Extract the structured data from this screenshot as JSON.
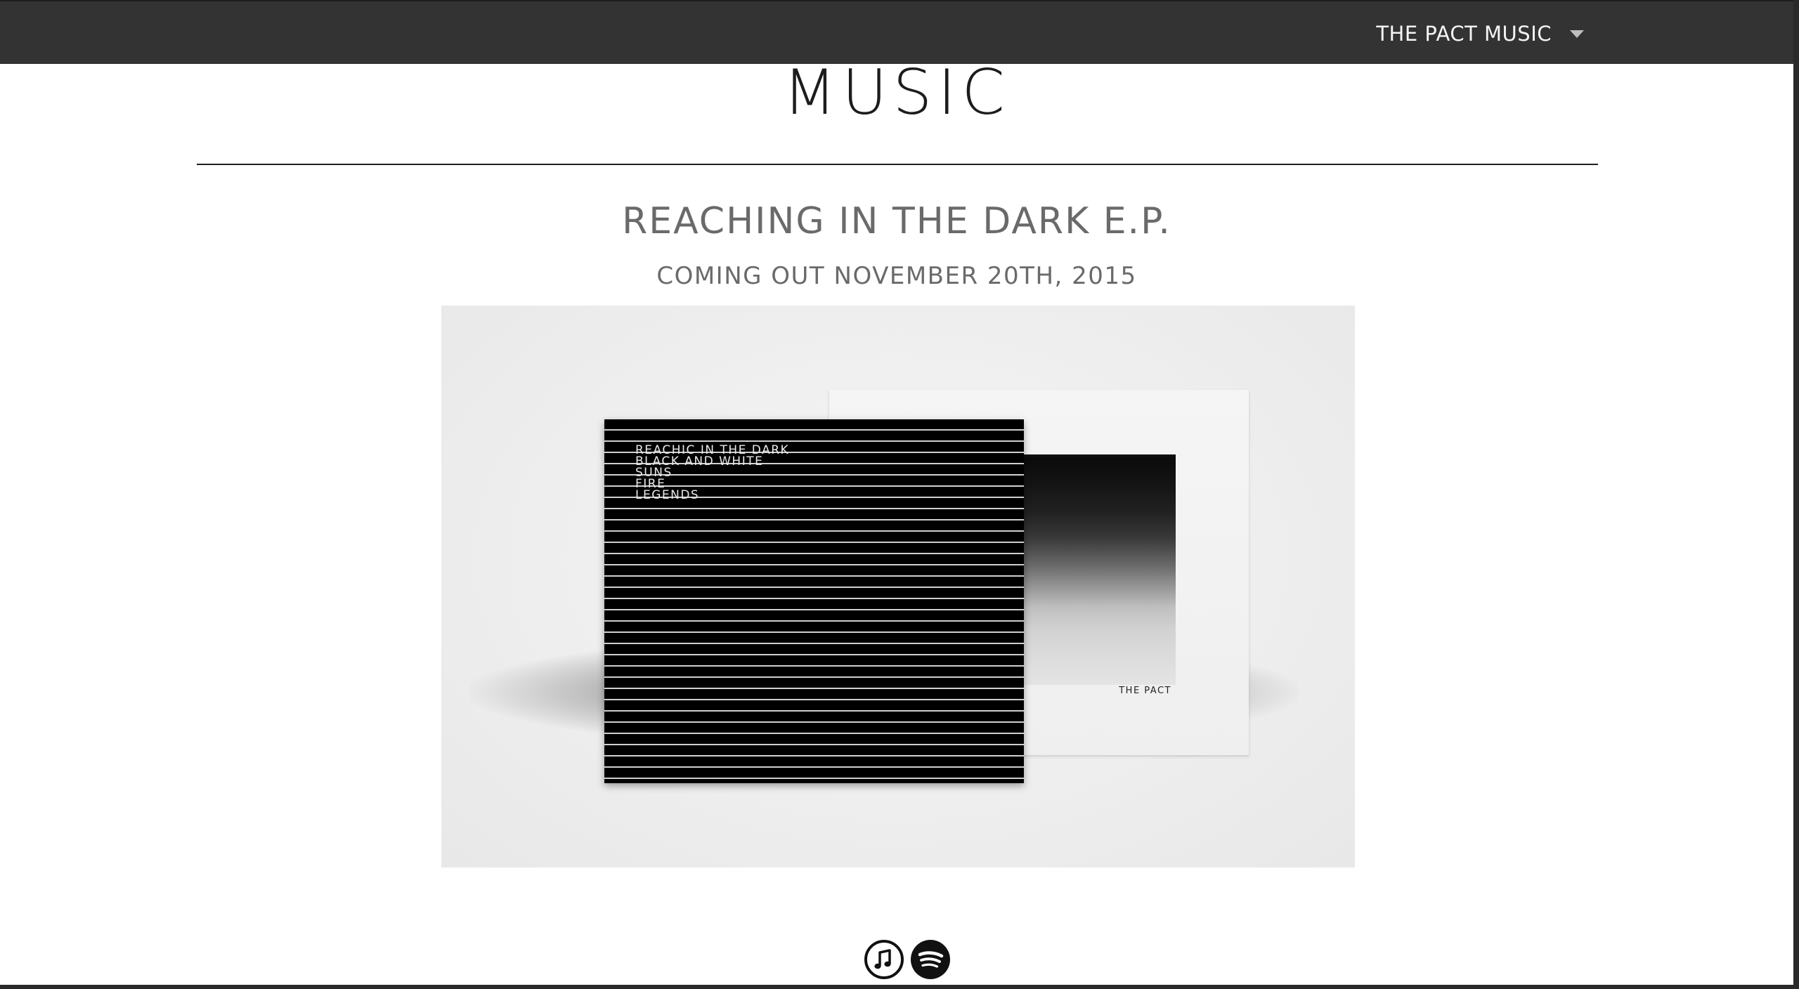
{
  "nav": {
    "menu_label": "THE PACT MUSIC"
  },
  "page": {
    "title": "MUSIC"
  },
  "release": {
    "title": "REACHING IN THE DARK E.P.",
    "subtitle": "COMING OUT NOVEMBER 20TH, 2015",
    "artwork": {
      "tracklist": [
        "REACHIC IN THE DARK",
        "BLACK AND WHITE",
        "SUNS",
        "FIRE",
        "LEGENDS"
      ],
      "artist_label": "THE PACT"
    }
  },
  "links": [
    {
      "name": "itunes",
      "icon": "music-note-icon"
    },
    {
      "name": "spotify",
      "icon": "spotify-icon"
    }
  ],
  "colors": {
    "topbar": "#333333",
    "text_dark": "#1c1c1c",
    "text_muted": "#6a6a6a",
    "panel": "#ececec"
  }
}
